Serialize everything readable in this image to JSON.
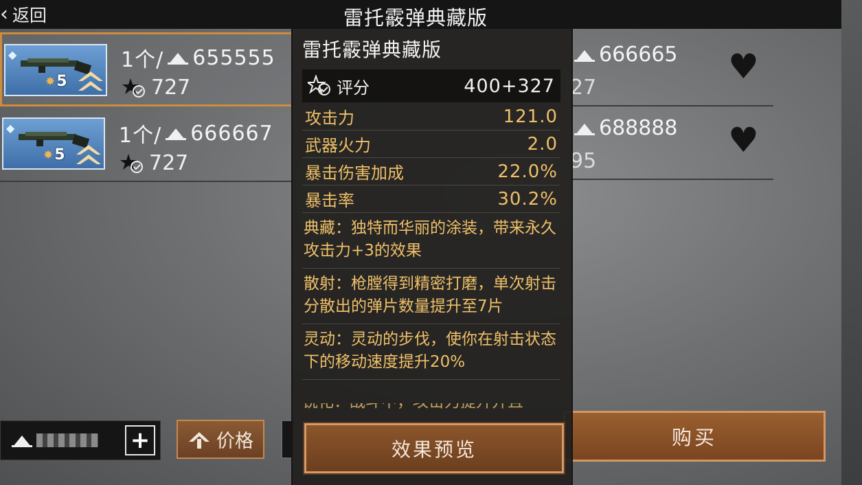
{
  "header": {
    "back_label": "返回",
    "title": "雷托霰弹典藏版"
  },
  "listings_left": [
    {
      "quantity_label": "1个/",
      "price": "655555",
      "score": "727",
      "level": "5",
      "selected": true
    },
    {
      "quantity_label": "1个/",
      "price": "666667",
      "score": "727",
      "level": "5",
      "selected": false
    }
  ],
  "listings_right": [
    {
      "price": "666665",
      "score": "27"
    },
    {
      "price": "688888",
      "score": "95"
    }
  ],
  "popup": {
    "title": "雷托霰弹典藏版",
    "score_label": "评分",
    "score_value": "400+327",
    "stats": [
      {
        "label": "攻击力",
        "value": "121.0"
      },
      {
        "label": "武器火力",
        "value": "2.0"
      },
      {
        "label": "暴击伤害加成",
        "value": "22.0%"
      },
      {
        "label": "暴击率",
        "value": "30.2%"
      }
    ],
    "descriptions": [
      "典藏：独特而华丽的涂装，带来永久攻击力+3的效果",
      "散射：枪膛得到精密打磨，单次射击分散出的弹片数量提升至7片",
      "灵动：灵动的步伐，使你在射击状态下的移动速度提升20%"
    ],
    "truncated_line": "锐化：战斗中，攻击力提升并且",
    "preview_button": "效果预览"
  },
  "bottom": {
    "sort_label": "价格",
    "plus_label": "+",
    "buy_label": "购买"
  },
  "colors": {
    "accent_gold": "#efc069",
    "button_brown": "#8b552c",
    "selection_border": "#d08b3d"
  },
  "icons": [
    "back-chevron-icon",
    "gem-icon",
    "star-icon",
    "rank-up-icon",
    "coin-icon",
    "score-badge-icon",
    "heart-icon",
    "plus-icon",
    "sort-up-icon"
  ]
}
